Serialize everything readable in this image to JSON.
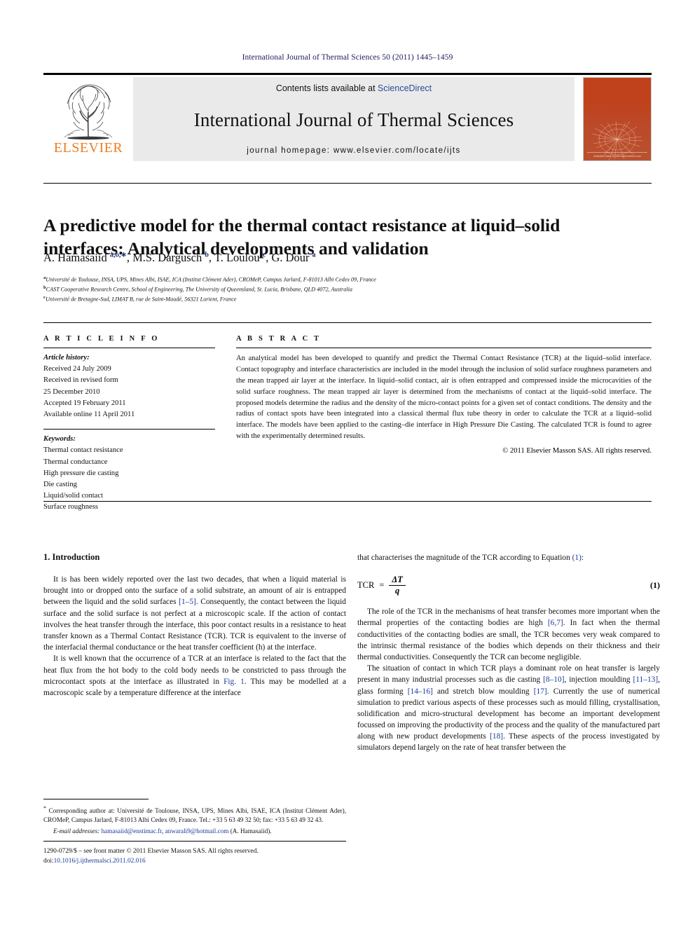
{
  "running_head": "International Journal of Thermal Sciences 50 (2011) 1445–1459",
  "banner": {
    "publisher_name": "ELSEVIER",
    "contents_prefix": "Contents lists available at ",
    "sciencedirect": "ScienceDirect",
    "journal_title": "International Journal of Thermal Sciences",
    "homepage": "journal homepage: www.elsevier.com/locate/ijts",
    "cover_title": "International Journal of Thermal Sciences",
    "cover_footer": "Available online at www.sciencedirect.com",
    "accent_orange": "#ef7d20",
    "cover_red": "#c0421d",
    "link_blue": "#2a4b9b"
  },
  "article": {
    "title": "A predictive model for the thermal contact resistance at liquid–solid interfaces: Analytical developments and validation",
    "authors_html": "A. Hamasaiid <sup>a,b,∗</sup>, M.S. Dargusch <sup>b</sup>, T. Loulou <sup>c</sup>, G. Dour <sup>a</sup>",
    "affiliations": [
      {
        "marker": "a",
        "text": "Université de Toulouse, INSA, UPS, Mines Albi, ISAE, ICA (Institut Clément Ader), CROMeP, Campus Jarlard, F-81013 Albi Cedex 09, France"
      },
      {
        "marker": "b",
        "text": "CAST Cooperative Research Centre, School of Engineering, The University of Queensland, St. Lucia, Brisbane, QLD 4072, Australia"
      },
      {
        "marker": "c",
        "text": "Université de Bretagne-Sud, LIMAT B, rue de Saint-Maudé, 56321 Lorient, France"
      }
    ]
  },
  "article_info": {
    "label": "A R T I C L E  I N F O",
    "history_label": "Article history:",
    "history": [
      "Received 24 July 2009",
      "Received in revised form",
      "25 December 2010",
      "Accepted 19 February 2011",
      "Available online 11 April 2011"
    ],
    "keywords_label": "Keywords:",
    "keywords": [
      "Thermal contact resistance",
      "Thermal conductance",
      "High pressure die casting",
      "Die casting",
      "Liquid/solid contact",
      "Surface roughness"
    ]
  },
  "abstract": {
    "label": "A B S T R A C T",
    "text": "An analytical model has been developed to quantify and predict the Thermal Contact Resistance (TCR) at the liquid–solid interface. Contact topography and interface characteristics are included in the model through the inclusion of solid surface roughness parameters and the mean trapped air layer at the interface. In liquid–solid contact, air is often entrapped and compressed inside the microcavities of the solid surface roughness. The mean trapped air layer is determined from the mechanisms of contact at the liquid–solid interface. The proposed models determine the radius and the density of the micro-contact points for a given set of contact conditions. The density and the radius of contact spots have been integrated into a classical thermal flux tube theory in order to calculate the TCR at a liquid–solid interface. The models have been applied to the casting–die interface in High Pressure Die Casting. The calculated TCR is found to agree with the experimentally determined results.",
    "copyright": "© 2011 Elsevier Masson SAS. All rights reserved."
  },
  "body": {
    "section_heading": "1. Introduction",
    "left": {
      "p1_a": "It is has been widely reported over the last two decades, that when a liquid material is brought into or dropped onto the surface of a solid substrate, an amount of air is entrapped between the liquid and the solid surfaces ",
      "p1_ref": "[1–5]",
      "p1_b": ". Consequently, the contact between the liquid surface and the solid surface is not perfect at a microscopic scale. If the action of contact involves the heat transfer through the interface, this poor contact results in a resistance to heat transfer known as a Thermal Contact Resistance (TCR). TCR is equivalent to the inverse of the interfacial thermal conductance or the heat transfer coefficient (h) at the interface.",
      "p2_a": "It is well known that the occurrence of a TCR at an interface is related to the fact that the heat flux from the hot body to the cold body needs to be constricted to pass through the microcontact spots at the interface as illustrated in ",
      "p2_ref": "Fig. 1",
      "p2_b": ". This may be modelled at a macroscopic scale by a temperature difference at the interface"
    },
    "right": {
      "p0_a": "that characterises the magnitude of the TCR according to Equation ",
      "p0_ref": "(1)",
      "p0_b": ":",
      "equation": {
        "lhs": "TCR",
        "eq": "=",
        "numerator": "ΔT",
        "denominator": "q",
        "number": "(1)"
      },
      "p1_a": "The role of the TCR in the mechanisms of heat transfer becomes more important when the thermal properties of the contacting bodies are high ",
      "p1_ref": "[6,7]",
      "p1_b": ". In fact when the thermal conductivities of the contacting bodies are small, the TCR becomes very weak compared to the intrinsic thermal resistance of the bodies which depends on their thickness and their thermal conductivities. Consequently the TCR can become negligible.",
      "p2_a": "The situation of contact in which TCR plays a dominant role on heat transfer is largely present in many industrial processes such as die casting ",
      "p2_ref1": "[8–10]",
      "p2_b": ", injection moulding ",
      "p2_ref2": "[11–13]",
      "p2_c": ", glass forming ",
      "p2_ref3": "[14–16]",
      "p2_d": " and stretch blow moulding ",
      "p2_ref4": "[17]",
      "p2_e": ". Currently the use of numerical simulation to predict various aspects of these processes such as mould filling, crystallisation, solidification and micro-structural development has become an important development focussed on improving the productivity of the process and the quality of the manufactured part along with new product developments ",
      "p2_ref5": "[18]",
      "p2_f": ". These aspects of the process investigated by simulators depend largely on the rate of heat transfer between the"
    }
  },
  "footnote": {
    "corresponding": "Corresponding author at: Université de Toulouse, INSA, UPS, Mines Albi, ISAE, ICA (Institut Clément Ader), CROMeP, Campus Jarlard, F-81013 Albi Cedex 09, France. Tel.: +33 5 63 49 32 50; fax: +33 5 63 49 32 43.",
    "email_label": "E-mail addresses:",
    "email1": "hamasaiid@enstimac.fr",
    "email2": "anwarali9@hotmail.com",
    "email_suffix": "(A. Hamasaiid)."
  },
  "footer": {
    "issn_line": "1290-0729/$ – see front matter © 2011 Elsevier Masson SAS. All rights reserved.",
    "doi_label": "doi:",
    "doi": "10.1016/j.ijthermalsci.2011.02.016"
  }
}
